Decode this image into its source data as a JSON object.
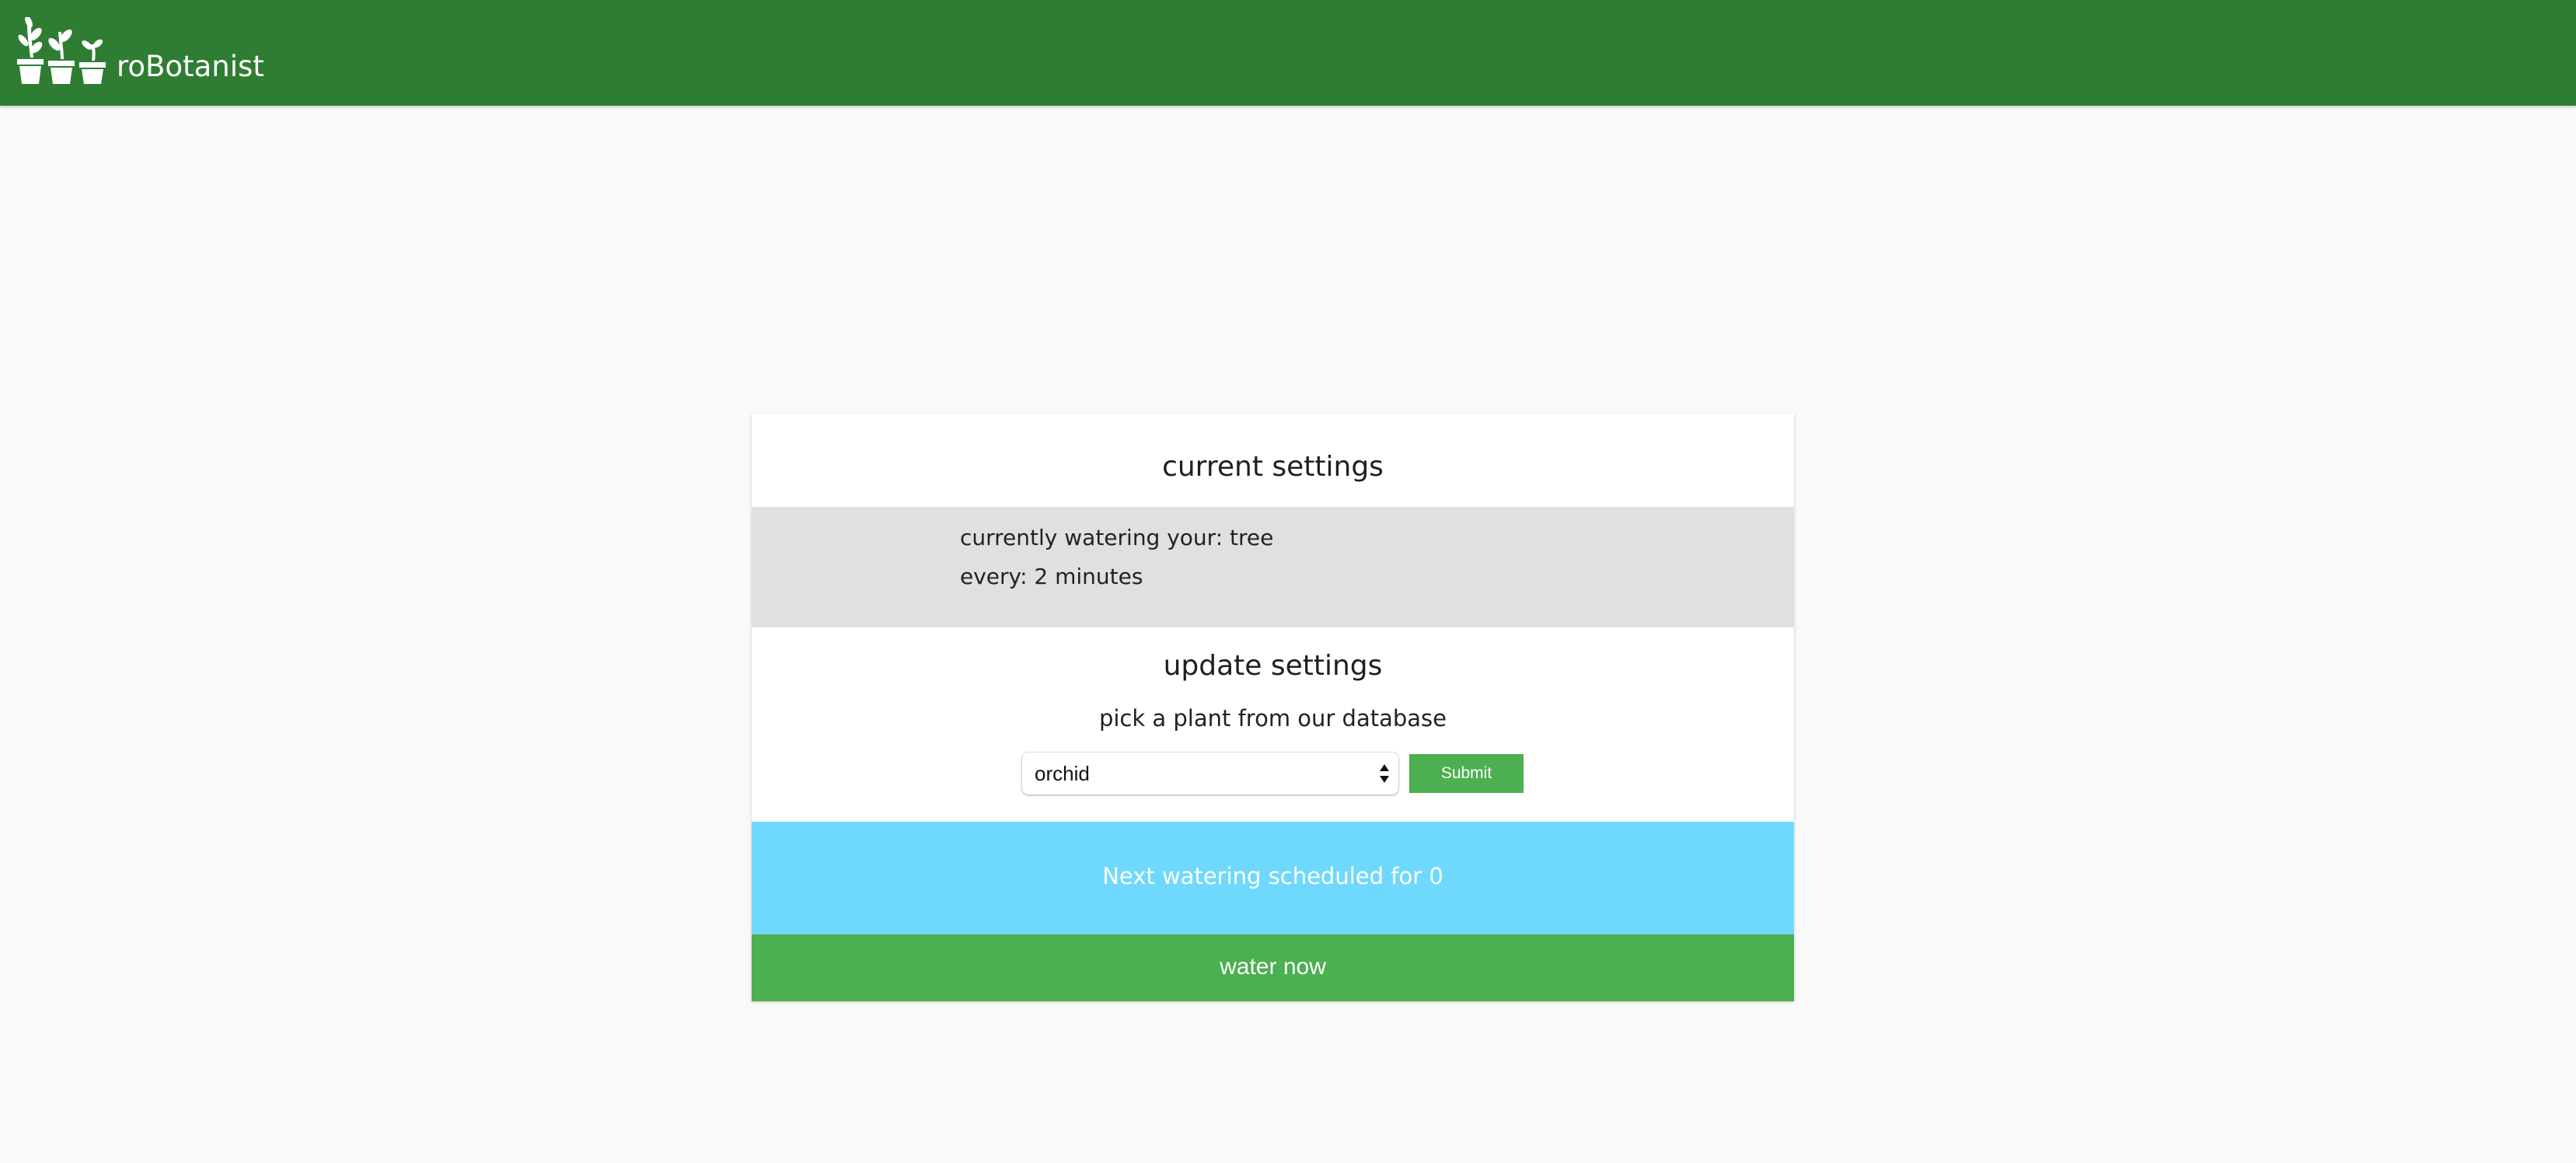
{
  "header": {
    "app_title": "roBotanist",
    "logo_icon": "three-potted-plants-icon",
    "background_color": "#2e7d32"
  },
  "current_settings": {
    "title": "current settings",
    "watering_line": "currently watering your: tree",
    "interval_line": "every: 2 minutes"
  },
  "update_settings": {
    "title": "update settings",
    "prompt": "pick a plant from our database",
    "selected_plant": "orchid",
    "submit_label": "Submit",
    "select_icon": "up-down-arrow-icon"
  },
  "schedule": {
    "text": "Next watering scheduled for 0",
    "background_color": "#6fd9fd"
  },
  "actions": {
    "water_now_label": "water now",
    "accent_color": "#4caf50"
  }
}
